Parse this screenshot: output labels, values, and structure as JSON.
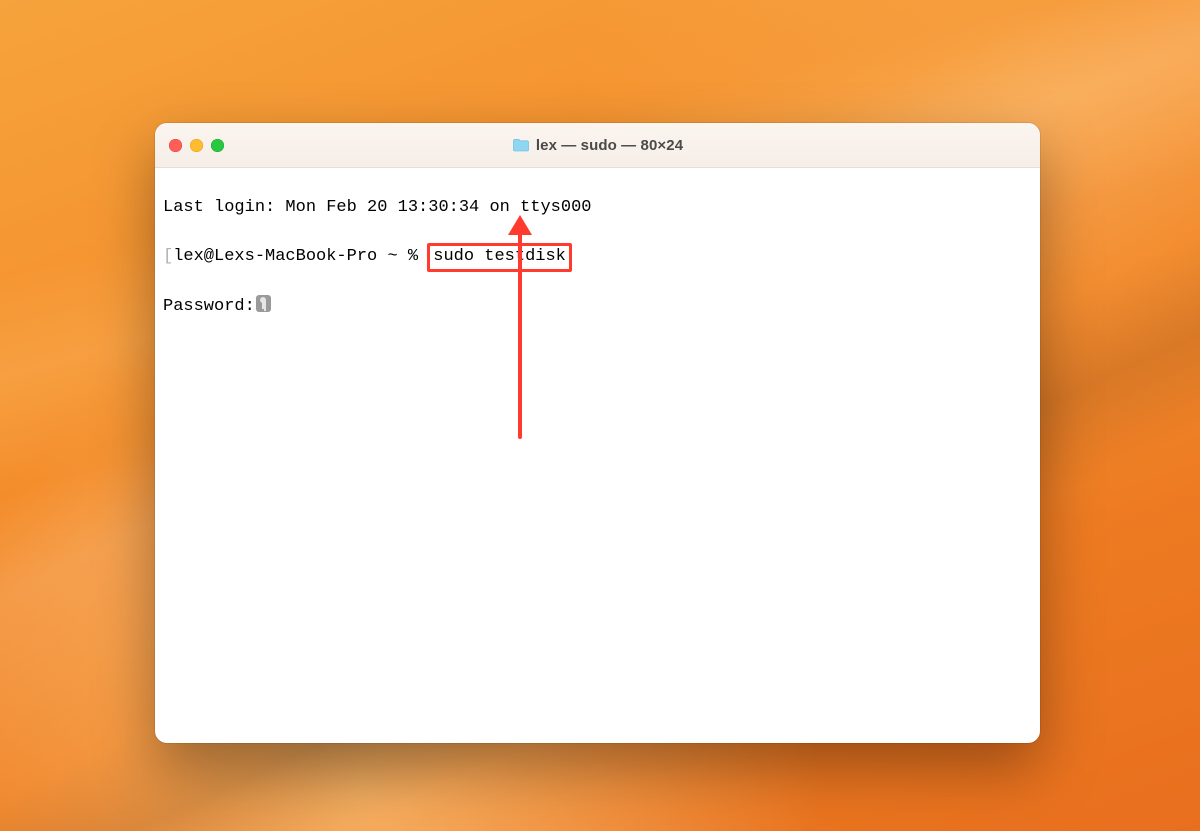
{
  "window": {
    "title": "lex — sudo — 80×24"
  },
  "terminal": {
    "last_login": "Last login: Mon Feb 20 13:30:34 on ttys000",
    "prompt_prefix": "lex@Lexs-MacBook-Pro ~ % ",
    "command": "sudo testdisk",
    "password_label": "Password:"
  },
  "annotation": {
    "highlight_target": "sudo testdisk",
    "color": "#ff3b2f"
  }
}
